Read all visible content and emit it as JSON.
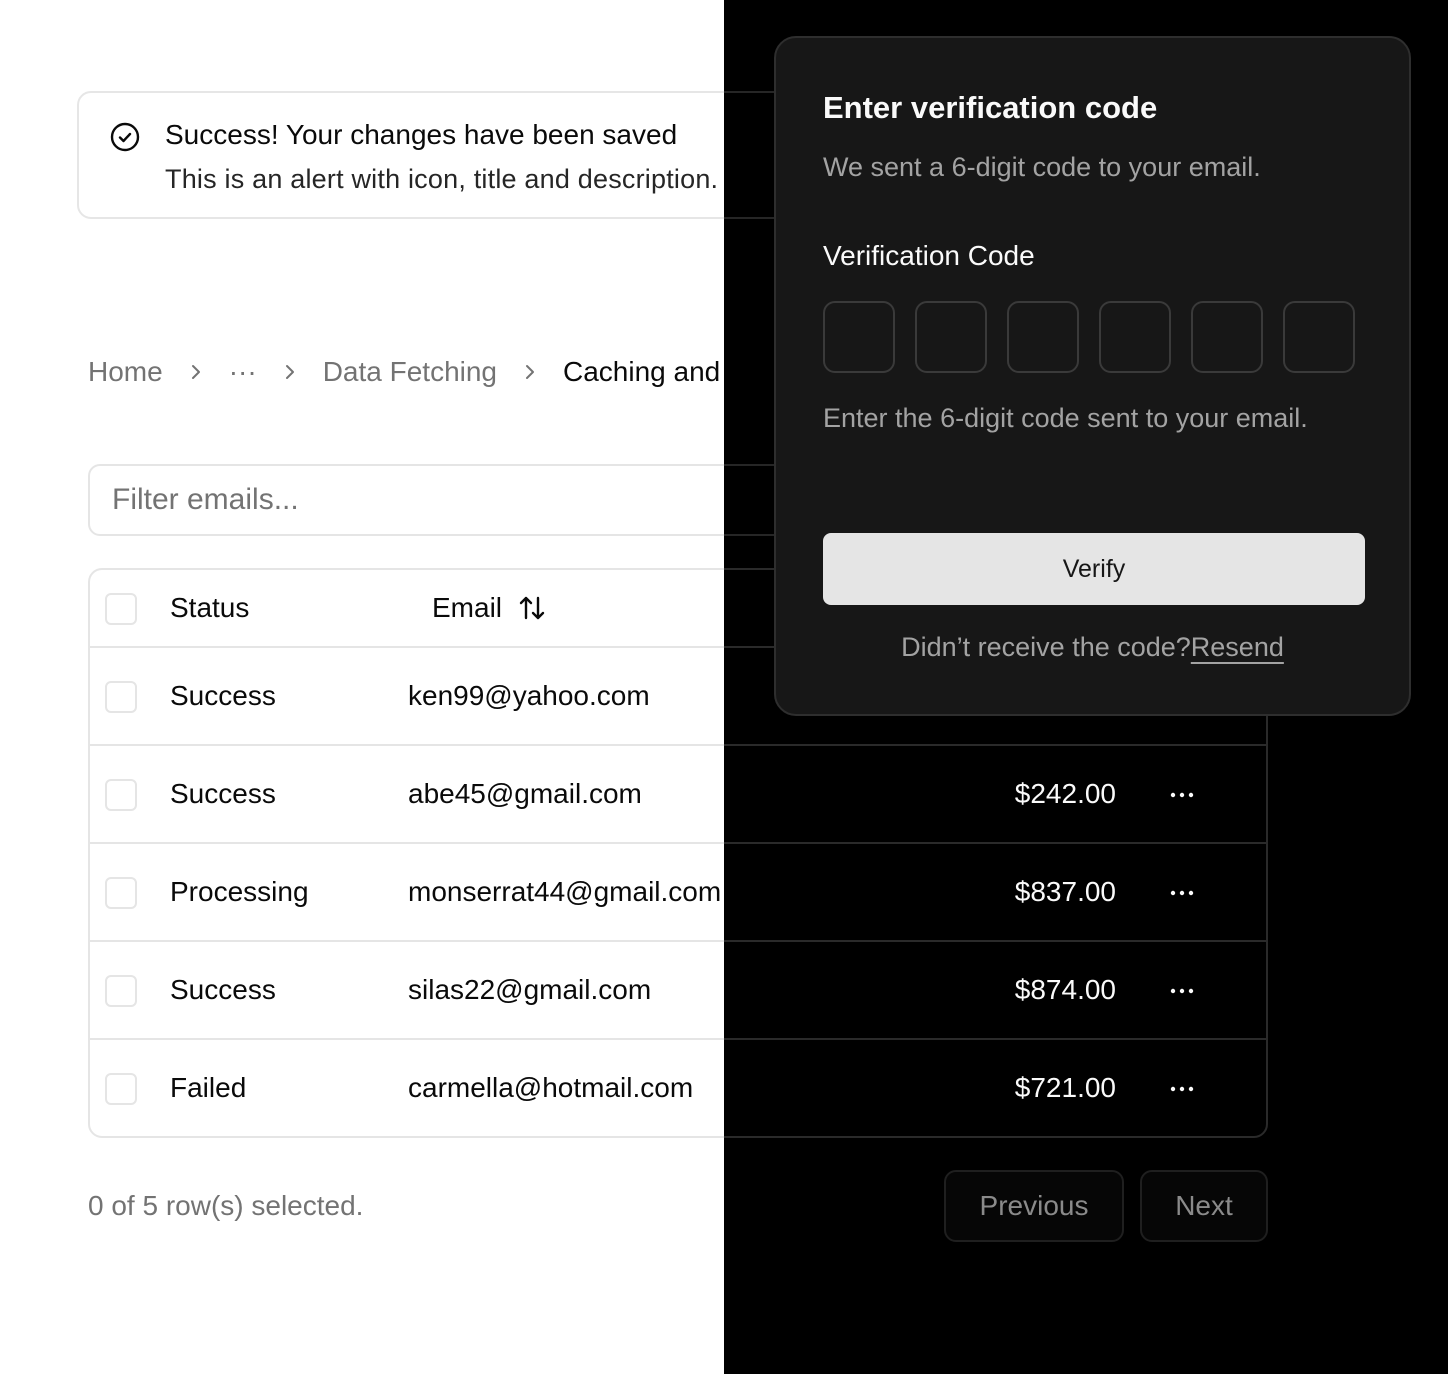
{
  "alert": {
    "title": "Success! Your changes have been saved",
    "description": "This is an alert with icon, title and description."
  },
  "breadcrumb": {
    "items": [
      "Home",
      "···",
      "Data Fetching",
      "Caching and Reva"
    ]
  },
  "filter": {
    "placeholder": "Filter emails..."
  },
  "table": {
    "headers": {
      "status": "Status",
      "email": "Email"
    },
    "rows": [
      {
        "status": "Success",
        "email": "ken99@yahoo.com",
        "amount": ""
      },
      {
        "status": "Success",
        "email": "abe45@gmail.com",
        "amount": "$242.00"
      },
      {
        "status": "Processing",
        "email": "monserrat44@gmail.com",
        "amount": "$837.00"
      },
      {
        "status": "Success",
        "email": "silas22@gmail.com",
        "amount": "$874.00"
      },
      {
        "status": "Failed",
        "email": "carmella@hotmail.com",
        "amount": "$721.00"
      }
    ]
  },
  "footer": {
    "selection_text": "0 of 5 row(s) selected.",
    "previous_label": "Previous",
    "next_label": "Next"
  },
  "verification": {
    "title": "Enter verification code",
    "subtitle": "We sent a 6-digit code to your email.",
    "field_label": "Verification Code",
    "help_text": "Enter the 6-digit code sent to your email.",
    "verify_label": "Verify",
    "resend_prompt": "Didn’t receive the code?",
    "resend_link": "Resend"
  },
  "colors": {
    "light_bg": "#ffffff",
    "dark_bg": "#000000",
    "card_bg": "#171717",
    "border_light": "#e5e5e5",
    "border_dark": "#2a2a2a",
    "button_light": "#e5e5e5"
  },
  "icons": {
    "alert": "check-circle-icon",
    "separator": "chevron-right-icon",
    "sort": "arrows-up-down-icon",
    "row_action": "more-horizontal-icon"
  }
}
